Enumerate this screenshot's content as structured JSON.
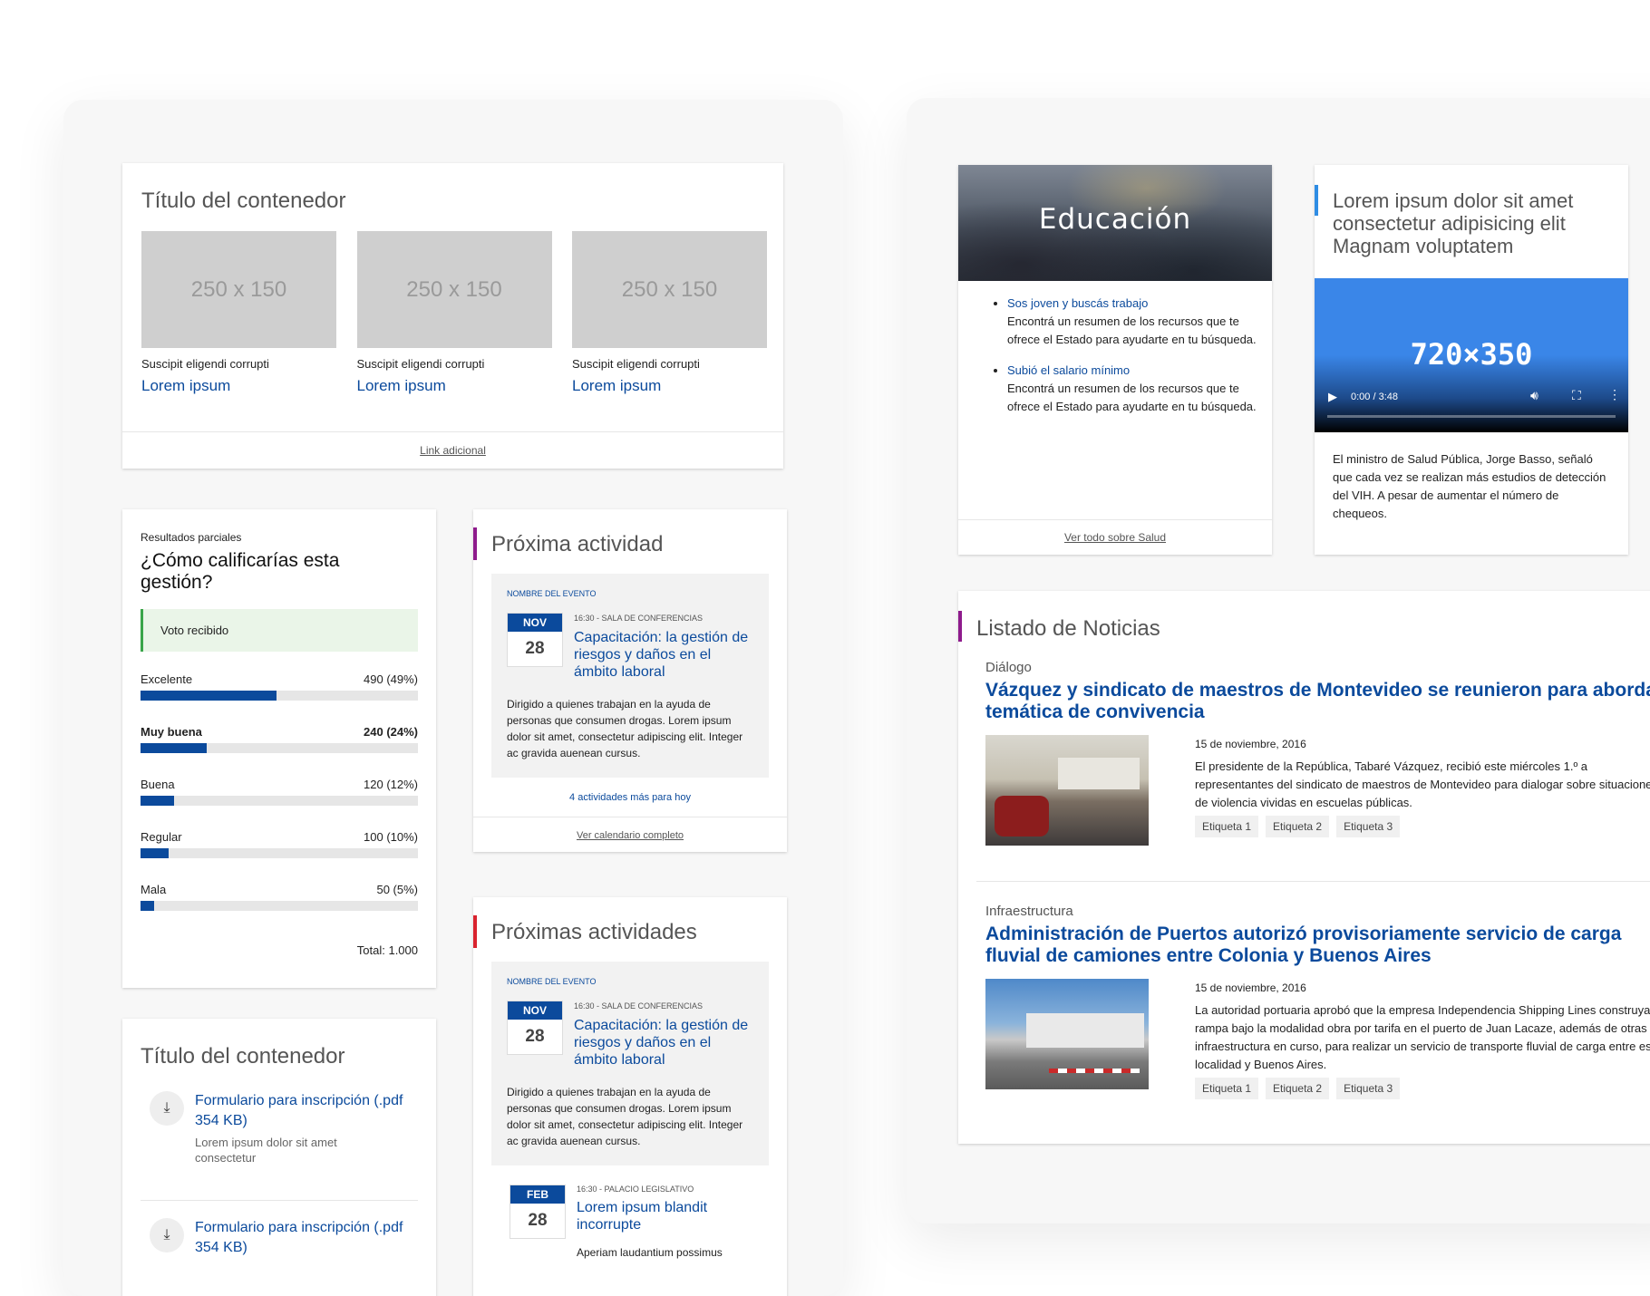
{
  "gallery": {
    "title": "Título del contenedor",
    "items": [
      {
        "placeholder": "250 x 150",
        "caption": "Suscipit eligendi corrupti",
        "link": "Lorem ipsum"
      },
      {
        "placeholder": "250 x 150",
        "caption": "Suscipit eligendi corrupti",
        "link": "Lorem ipsum"
      },
      {
        "placeholder": "250 x 150",
        "caption": "Suscipit eligendi corrupti",
        "link": "Lorem ipsum"
      }
    ],
    "footer_link": "Link adicional"
  },
  "poll": {
    "kicker": "Resultados parciales",
    "question": "¿Cómo calificarías esta gestión?",
    "notice": "Voto recibido",
    "options": [
      {
        "label": "Excelente",
        "value": "490 (49%)",
        "pct": 49,
        "bold": false
      },
      {
        "label": "Muy buena",
        "value": "240 (24%)",
        "pct": 24,
        "bold": true
      },
      {
        "label": "Buena",
        "value": "120 (12%)",
        "pct": 12,
        "bold": false
      },
      {
        "label": "Regular",
        "value": "100 (10%)",
        "pct": 10,
        "bold": false
      },
      {
        "label": "Mala",
        "value": "50 (5%)",
        "pct": 5,
        "bold": false
      }
    ],
    "total": "Total: 1.000"
  },
  "downloads": {
    "title": "Título del contenedor",
    "items": [
      {
        "title": "Formulario para inscripción (.pdf 354 KB)",
        "desc": "Lorem ipsum dolor sit amet consectetur"
      },
      {
        "title": "Formulario para inscripción (.pdf 354 KB)",
        "desc": ""
      }
    ]
  },
  "next_activity": {
    "title": "Próxima actividad",
    "accent": "#8e1b8c",
    "event": {
      "kicker": "NOMBRE DEL EVENTO",
      "month": "NOV",
      "day": "28",
      "meta": "16:30 - SALA DE CONFERENCIAS",
      "title": "Capacitación: la gestión de riesgos y daños en el ámbito laboral",
      "desc": "Dirigido a quienes trabajan en la ayuda de personas que consumen drogas. Lorem ipsum dolor sit amet, consectetur adipiscing elit. Integer ac gravida auenean cursus."
    },
    "more": "4 actividades más para hoy",
    "footer_link": "Ver calendario completo"
  },
  "next_activities": {
    "title": "Próximas actividades",
    "accent": "#d9232e",
    "event": {
      "kicker": "NOMBRE DEL EVENTO",
      "month": "NOV",
      "day": "28",
      "meta": "16:30 - SALA DE CONFERENCIAS",
      "title": "Capacitación: la gestión de riesgos y daños en el ámbito laboral",
      "desc": "Dirigido a quienes trabajan en la ayuda de personas que consumen drogas. Lorem ipsum dolor sit amet, consectetur adipiscing elit. Integer ac gravida auenean cursus."
    },
    "event2": {
      "month": "FEB",
      "day": "28",
      "meta": "16:30 - PALACIO LEGISLATIVO",
      "title": "Lorem ipsum blandit incorrupte",
      "desc": "Aperiam laudantium possimus"
    }
  },
  "education": {
    "banner": "Educación",
    "items": [
      {
        "link": "Sos joven y buscás trabajo",
        "text": "Encontrá un resumen de los recursos que te ofrece el Estado para ayudarte en tu búsqueda."
      },
      {
        "link": "Subió el salario mínimo",
        "text": "Encontrá un resumen de los recursos que te ofrece el Estado para ayudarte en tu búsqueda."
      }
    ],
    "footer_link": "Ver todo sobre Salud"
  },
  "video_card": {
    "title": "Lorem ipsum dolor sit amet consectetur adipisicing elit Magnam voluptatem",
    "accent": "#2f8de4",
    "video_label": "720×350",
    "time": "0:00 / 3:48",
    "text": "El ministro de Salud Pública, Jorge Basso, señaló que cada vez se realizan más estudios de detección del VIH. A pesar de aumentar el número de chequeos."
  },
  "news": {
    "title": "Listado de Noticias",
    "accent": "#8e1b8c",
    "items": [
      {
        "category": "Diálogo",
        "headline": "Vázquez y sindicato de maestros de Montevideo se reunieron para abordar temática de convivencia",
        "date": "15 de noviembre, 2016",
        "text": "El presidente de la República, Tabaré Vázquez, recibió este miércoles 1.º a representantes del sindicato de maestros de Montevideo para dialogar sobre situaciones de violencia vividas en escuelas públicas.",
        "tags": [
          "Etiqueta 1",
          "Etiqueta 2",
          "Etiqueta 3"
        ]
      },
      {
        "category": "Infraestructura",
        "headline": "Administración de Puertos autorizó provisoriamente servicio de carga fluvial de camiones entre Colonia y Buenos Aires",
        "date": "15 de noviembre, 2016",
        "text": "La autoridad portuaria aprobó que la empresa Independencia Shipping Lines construya una rampa bajo la modalidad obra por tarifa en el puerto de Juan Lacaze, además de otras obras de infraestructura en curso, para realizar un servicio de transporte fluvial de carga entre esa localidad y Buenos Aires.",
        "tags": [
          "Etiqueta 1",
          "Etiqueta 2",
          "Etiqueta 3"
        ]
      }
    ]
  }
}
